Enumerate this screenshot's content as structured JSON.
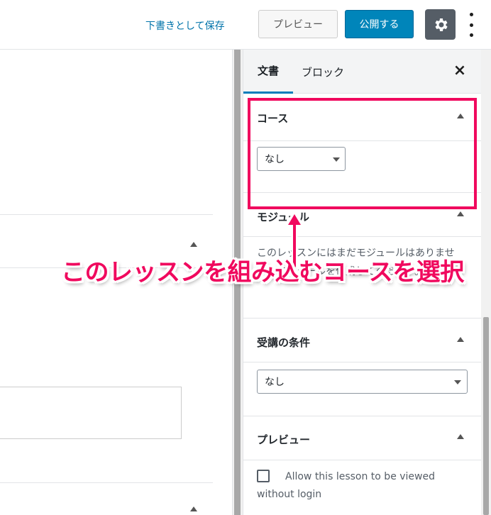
{
  "topbar": {
    "save_draft_label": "下書きとして保存",
    "preview_label": "プレビュー",
    "publish_label": "公開する"
  },
  "sidebar": {
    "tabs": [
      {
        "label": "文書",
        "active": true
      },
      {
        "label": "ブロック",
        "active": false
      }
    ],
    "panels": {
      "course": {
        "title": "コース",
        "selected": "なし"
      },
      "module": {
        "title": "モジュール",
        "text": "このレッスンにはまだモジュールはありません。モジュールを作成してください。"
      },
      "prerequisite": {
        "title": "受講の条件",
        "selected": "なし"
      },
      "preview": {
        "title": "プレビュー",
        "checkbox_label": "Allow this lesson to be viewed without login",
        "checked": false
      }
    }
  },
  "annotation": {
    "text": "このレッスンを組み込むコースを選択",
    "color": "#f0095e"
  },
  "colors": {
    "accent": "#007cba",
    "publish": "#0085ba",
    "link": "#0073aa"
  }
}
